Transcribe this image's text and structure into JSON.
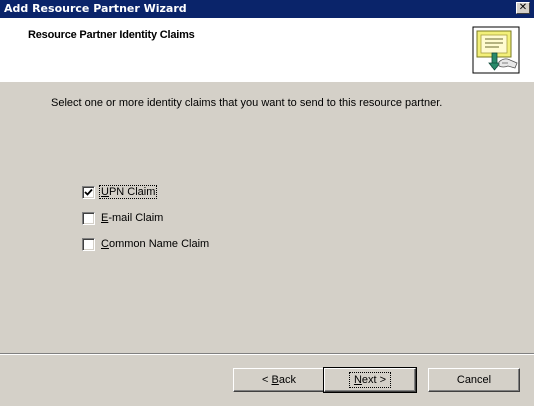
{
  "window": {
    "title": "Add Resource Partner Wizard"
  },
  "header": {
    "title": "Resource Partner Identity Claims",
    "icon": "partner-claims-icon"
  },
  "instruction": "Select one or more identity claims that you want to send to this resource partner.",
  "claims": [
    {
      "access_key": "U",
      "rest": "PN Claim",
      "label": "UPN Claim",
      "checked": true,
      "focused": true
    },
    {
      "access_key": "E",
      "rest": "-mail Claim",
      "label": "E-mail Claim",
      "checked": false,
      "focused": false
    },
    {
      "access_key": "C",
      "rest": "ommon Name Claim",
      "label": "Common Name Claim",
      "checked": false,
      "focused": false
    }
  ],
  "buttons": {
    "back": {
      "pre": "< ",
      "key": "B",
      "rest": "ack",
      "label": "< Back"
    },
    "next": {
      "pre": "",
      "key": "N",
      "rest": "ext >",
      "label": "Next >"
    },
    "cancel": {
      "label": "Cancel"
    }
  },
  "colors": {
    "titlebar": "#0a246a",
    "dialog_bg": "#d4d0c8",
    "header_bg": "#ffffff"
  }
}
